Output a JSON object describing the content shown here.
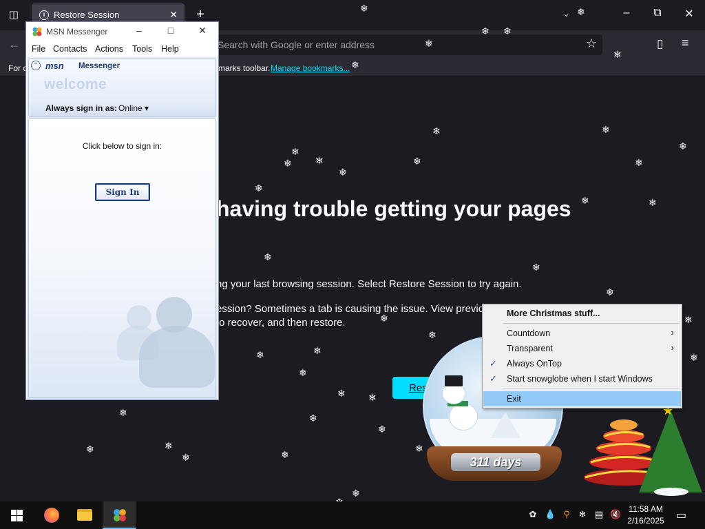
{
  "browser": {
    "tab_title": "Restore Session",
    "url_placeholder": "Search with Google or enter address",
    "bookmarks_left": "For q",
    "bookmarks_right": "marks toolbar.",
    "bookmarks_link": "Manage bookmarks..."
  },
  "page": {
    "heading": "having trouble getting your pages",
    "p1": "ng your last browsing session. Select Restore Session to try again.",
    "p2": "ession? Sometimes a tab is causing the issue. View previou",
    "p3": "to recover, and then restore.",
    "restore_button": "Res"
  },
  "msn": {
    "window_title": "MSN Messenger",
    "menu": [
      "File",
      "Contacts",
      "Actions",
      "Tools",
      "Help"
    ],
    "brand": "msn",
    "brand_product": "Messenger",
    "welcome": "welcome",
    "status_label": "Always sign in as:",
    "status_value": "Online",
    "prompt": "Click below to sign in:",
    "sign_in_button": "Sign In"
  },
  "snowglobe": {
    "countdown": "311 days"
  },
  "context_menu": {
    "items": [
      {
        "label": "More Christmas stuff...",
        "bold": true
      },
      {
        "label": "Countdown",
        "submenu": true
      },
      {
        "label": "Transparent",
        "submenu": true
      },
      {
        "label": "Always OnTop",
        "checked": true
      },
      {
        "label": "Start snowglobe when I start Windows",
        "checked": true
      },
      {
        "label": "Exit",
        "highlighted": true
      }
    ]
  },
  "taskbar": {
    "time": "11:58 AM",
    "date": "2/16/2025"
  },
  "colors": {
    "accent": "#00ddff",
    "menu_highlight": "#91c9f7",
    "taskbar_active": "#76b9ed"
  }
}
